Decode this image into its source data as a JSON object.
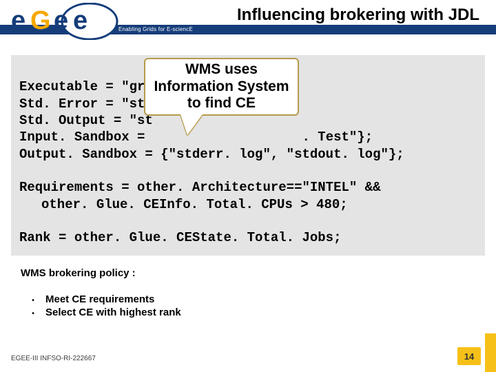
{
  "header": {
    "title": "Influencing brokering with JDL",
    "tagline": "Enabling Grids for E-sciencE",
    "logo_alt": "egee"
  },
  "code": {
    "l1": "Executable = \"grid. Test\";",
    "l2": "Std. Error = \"std",
    "l3": "Std. Output = \"st",
    "l4a": "Input. Sandbox = ",
    "l4b": ". Test\"};",
    "l5": "Output. Sandbox = {\"stderr. log\", \"stdout. log\"};",
    "blank": "",
    "l7": "Requirements = other. Architecture==\"INTEL\" &&",
    "l8": "other. Glue. CEInfo. Total. CPUs > 480;",
    "l9": "Rank = other. Glue. CEState. Total. Jobs;"
  },
  "callout": {
    "line1": "WMS uses",
    "line2": "Information System",
    "line3": "to find CE"
  },
  "policy": {
    "heading": "WMS brokering policy :",
    "b1": "Meet CE requirements",
    "b2": "Select CE with highest rank"
  },
  "footer": {
    "id": "EGEE-III INFSO-RI-222667",
    "page": "14"
  }
}
